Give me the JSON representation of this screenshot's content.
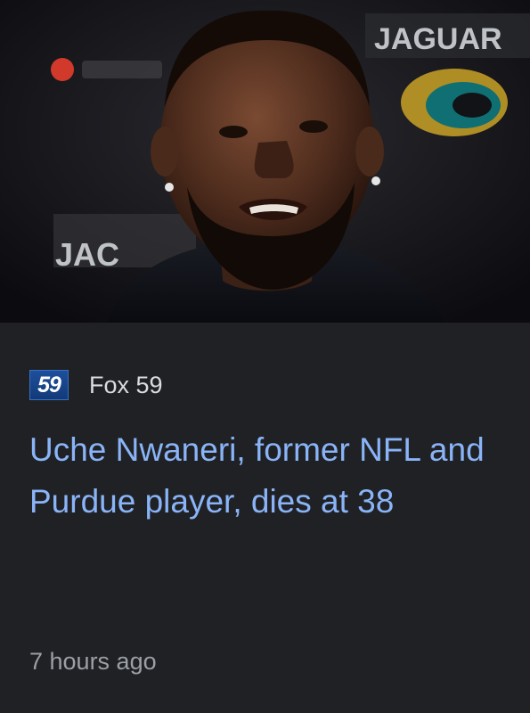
{
  "article": {
    "thumbnail": {
      "alt": "Uche Nwaneri at a Jacksonville Jaguars press conference",
      "background_text": "JAGUAR",
      "lower_text": "JAC"
    },
    "source": {
      "logo_text": "59",
      "name": "Fox 59"
    },
    "headline": "Uche Nwaneri, former NFL and Purdue player, dies at 38",
    "timestamp": "7 hours ago"
  },
  "colors": {
    "background": "#202124",
    "headline": "#8ab4f8",
    "source_text": "#dadce0",
    "timestamp": "#9aa0a6",
    "logo_blue": "#1d4f9c"
  }
}
